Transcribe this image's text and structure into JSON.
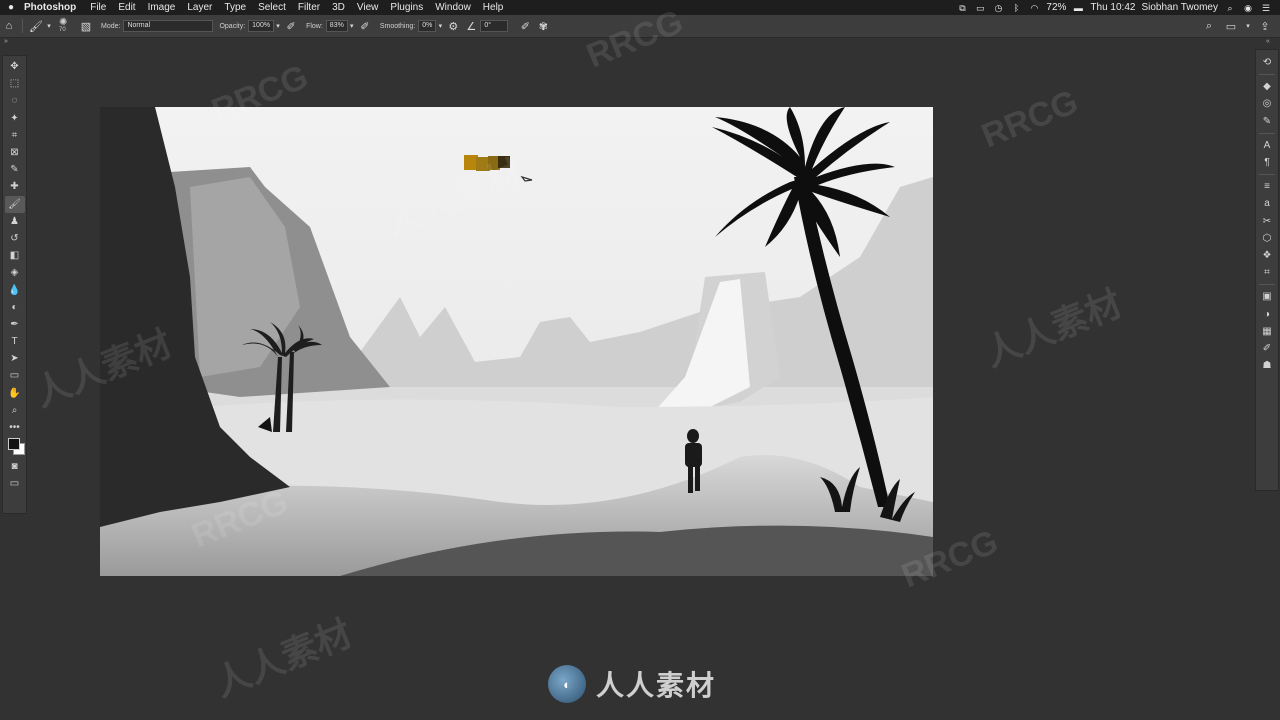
{
  "menubar": {
    "app_name": "Photoshop",
    "menus": [
      "File",
      "Edit",
      "Image",
      "Layer",
      "Type",
      "Select",
      "Filter",
      "3D",
      "View",
      "Plugins",
      "Window",
      "Help"
    ],
    "battery": "72%",
    "clock": "Thu 10:42",
    "user": "Siobhan Twomey"
  },
  "options": {
    "brush_size": "70",
    "mode_label": "Mode:",
    "mode_value": "Normal",
    "opacity_label": "Opacity:",
    "opacity_value": "100%",
    "flow_label": "Flow:",
    "flow_value": "83%",
    "smoothing_label": "Smoothing:",
    "smoothing_value": "0%",
    "angle_value": "0°"
  },
  "toolbar": {
    "tools": [
      {
        "name": "move-tool",
        "glyph": "✥"
      },
      {
        "name": "marquee-tool",
        "glyph": "⬚"
      },
      {
        "name": "lasso-tool",
        "glyph": "◌"
      },
      {
        "name": "magic-wand-tool",
        "glyph": "✦"
      },
      {
        "name": "crop-tool",
        "glyph": "⌗"
      },
      {
        "name": "frame-tool",
        "glyph": "⊠"
      },
      {
        "name": "eyedropper-tool",
        "glyph": "✎"
      },
      {
        "name": "healing-brush-tool",
        "glyph": "✚"
      },
      {
        "name": "brush-tool",
        "glyph": "🖌",
        "active": true
      },
      {
        "name": "clone-stamp-tool",
        "glyph": "♟"
      },
      {
        "name": "history-brush-tool",
        "glyph": "↺"
      },
      {
        "name": "eraser-tool",
        "glyph": "◧"
      },
      {
        "name": "paint-bucket-tool",
        "glyph": "◈"
      },
      {
        "name": "blur-tool",
        "glyph": "💧"
      },
      {
        "name": "dodge-tool",
        "glyph": "◐"
      },
      {
        "name": "pen-tool",
        "glyph": "✒"
      },
      {
        "name": "type-tool",
        "glyph": "T"
      },
      {
        "name": "path-selection-tool",
        "glyph": "➤"
      },
      {
        "name": "rectangle-tool",
        "glyph": "▭"
      },
      {
        "name": "hand-tool",
        "glyph": "✋"
      },
      {
        "name": "zoom-tool",
        "glyph": "⌕"
      },
      {
        "name": "more-tools",
        "glyph": "•••"
      }
    ],
    "colors": {
      "foreground": "#111111",
      "background": "#ffffff"
    }
  },
  "right_panel": {
    "icons": [
      "history-icon",
      "layers-icon",
      "channels-icon",
      "paths-icon",
      "character-icon",
      "paragraph-icon",
      "adjustments-icon",
      "glyphs-icon",
      "brush-settings-icon",
      "3d-icon",
      "styles-icon",
      "transform-icon",
      "properties-icon",
      "navigator-icon",
      "swatches-icon",
      "brushes-icon",
      "libraries-icon"
    ]
  },
  "watermark": {
    "brand": "RRCG",
    "cn_text": "人人素材"
  },
  "colors": {
    "menubar_bg": "#1e1e1e",
    "workspace_bg": "#323232",
    "panel_bg": "#3d3d3d",
    "ochre": "#b8860b"
  }
}
